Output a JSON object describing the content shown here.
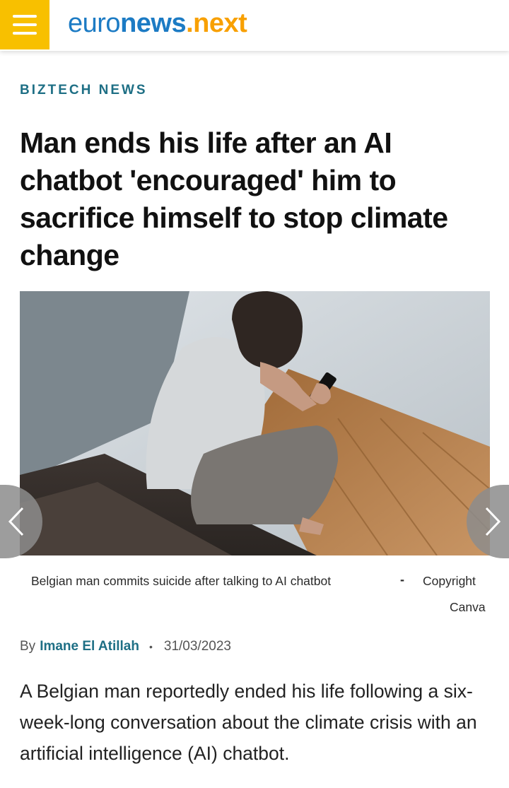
{
  "header": {
    "logo_euro": "euro",
    "logo_news": "news",
    "logo_dot": ".",
    "logo_next": "next"
  },
  "article": {
    "category": "BIZTECH NEWS",
    "headline": "Man ends his life after an AI chatbot 'encouraged' him to sacrifice himself to stop climate change",
    "caption": "Belgian man commits suicide after talking to AI chatbot",
    "caption_separator": "-",
    "copyright_label": "Copyright",
    "credit": "Canva",
    "byline_prefix": "By",
    "author": "Imane El Atillah",
    "bullet": "•",
    "date": "31/03/2023",
    "lead": "A Belgian man reportedly ended his life following a six-week-long conversation about the climate crisis with an artificial intelligence (AI) chatbot."
  },
  "icons": {
    "menu": "hamburger-icon",
    "prev": "chevron-left-icon",
    "next": "chevron-right-icon"
  },
  "colors": {
    "brand_blue": "#1c7bc4",
    "brand_yellow": "#f8c000",
    "accent_teal": "#1e6f85"
  }
}
